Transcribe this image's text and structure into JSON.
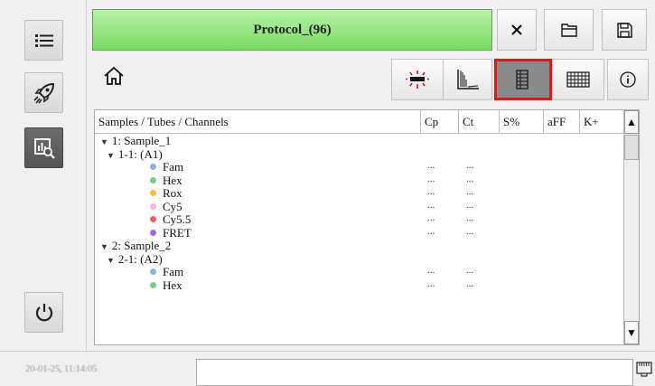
{
  "sidebar": {
    "items": [
      {
        "name": "menu",
        "icon": "hamburger-menu-icon"
      },
      {
        "name": "run",
        "icon": "rocket-icon"
      },
      {
        "name": "analysis",
        "icon": "chart-magnifier-icon",
        "active": true
      },
      {
        "name": "power",
        "icon": "power-icon"
      }
    ]
  },
  "header": {
    "title": "Protocol_(96)",
    "close_icon": "close-icon",
    "open_icon": "folder-open-icon",
    "save_icon": "save-icon"
  },
  "toolbar": {
    "home_icon": "home-icon",
    "views": [
      {
        "name": "optical-measurement",
        "icon": "led-icon"
      },
      {
        "name": "amplification-curves",
        "icon": "curve-chart-icon"
      },
      {
        "name": "tubes-list",
        "icon": "list-table-icon",
        "selected": true
      },
      {
        "name": "plate-grid",
        "icon": "grid-icon"
      },
      {
        "name": "info",
        "icon": "info-icon"
      }
    ]
  },
  "table": {
    "columns": [
      "Samples / Tubes / Channels",
      "Cp",
      "Ct",
      "S%",
      "aFF",
      "K+"
    ],
    "rows": [
      {
        "level": 0,
        "label": "1: Sample_1",
        "caret": true
      },
      {
        "level": 1,
        "label": "1-1:  (A1)",
        "caret": true
      },
      {
        "level": 2,
        "label": "Fam",
        "color": "#8fb2e0",
        "cp": "...",
        "ct": "..."
      },
      {
        "level": 2,
        "label": "Hex",
        "color": "#7cc98a",
        "cp": "...",
        "ct": "..."
      },
      {
        "level": 2,
        "label": "Rox",
        "color": "#f3c23e",
        "cp": "...",
        "ct": "..."
      },
      {
        "level": 2,
        "label": "Cy5",
        "color": "#f6b7e6",
        "cp": "...",
        "ct": "..."
      },
      {
        "level": 2,
        "label": "Cy5.5",
        "color": "#ef6060",
        "cp": "...",
        "ct": "..."
      },
      {
        "level": 2,
        "label": "FRET",
        "color": "#9b6ce0",
        "cp": "...",
        "ct": "..."
      },
      {
        "level": 0,
        "label": "2: Sample_2",
        "caret": true
      },
      {
        "level": 1,
        "label": "2-1:  (A2)",
        "caret": true
      },
      {
        "level": 2,
        "label": "Fam",
        "color": "#8fb2e0",
        "cp": "...",
        "ct": "..."
      },
      {
        "level": 2,
        "label": "Hex",
        "color": "#7cc98a",
        "cp": "...",
        "ct": "..."
      }
    ]
  },
  "status": {
    "datetime": "20-01-25, 11:14:05",
    "message": "",
    "network_icon": "network-icon"
  },
  "colors": {
    "title_green": "#78db64",
    "selected_border": "#e01818",
    "sidebar_active": "#545454"
  }
}
